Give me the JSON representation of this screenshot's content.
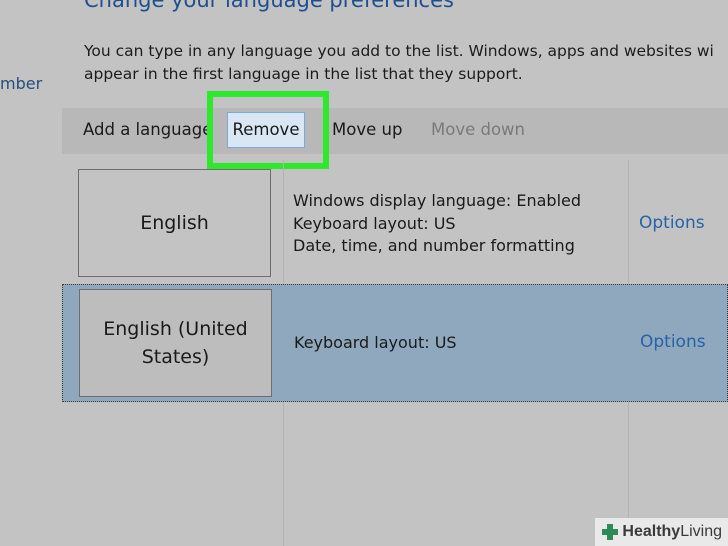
{
  "sidebar": {
    "fragment": "mber"
  },
  "header": {
    "title": "Change your language preferences",
    "description_line1": "You can type in any language you add to the list. Windows, apps and websites wi",
    "description_line2": "appear in the first language in the list that they support."
  },
  "toolbar": {
    "add_label": "Add a language",
    "remove_label": "Remove",
    "move_up_label": "Move up",
    "move_down_label": "Move down"
  },
  "languages": [
    {
      "name": "English",
      "details": [
        "Windows display language: Enabled",
        "Keyboard layout: US",
        "Date, time, and number formatting"
      ],
      "options_label": "Options"
    },
    {
      "name": "English (United States)",
      "details": [
        "Keyboard layout: US"
      ],
      "options_label": "Options"
    }
  ],
  "watermark": {
    "brand_bold": "Healthy",
    "brand_light": "Living",
    "icon": "plus-icon"
  },
  "colors": {
    "highlight": "#2ee82e",
    "link": "#2762a8",
    "selected_row": "#8fa8bd",
    "title": "#1f4f8f"
  }
}
